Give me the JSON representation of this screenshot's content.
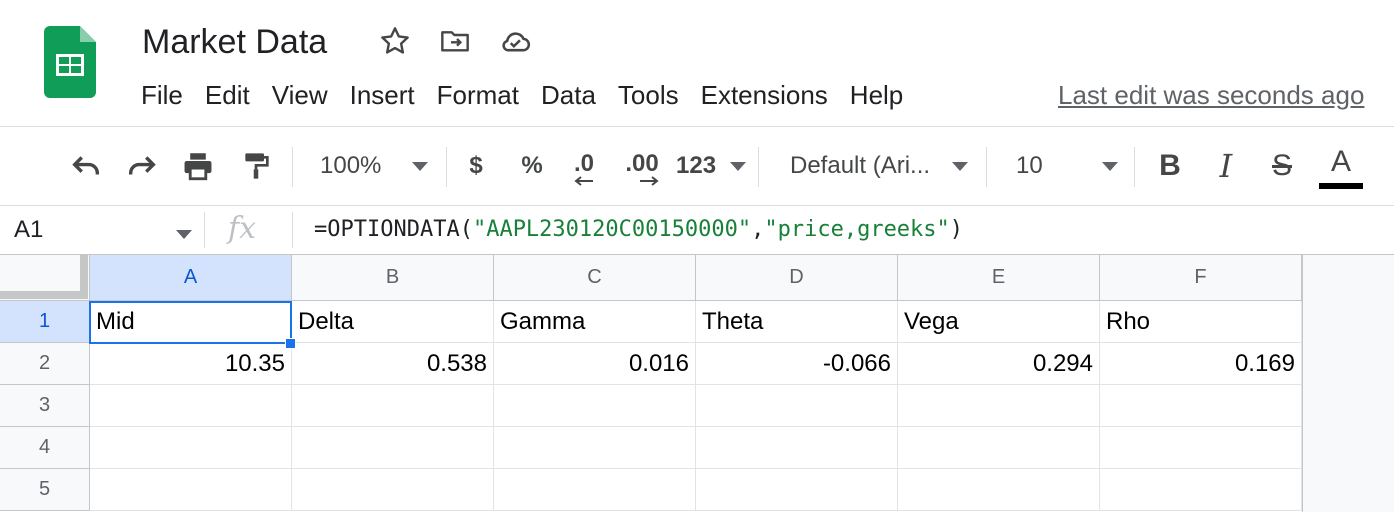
{
  "app": {
    "doc_title": "Market Data",
    "accent_green": "#0f9d58",
    "selection_blue": "#1a73e8",
    "icons": [
      "sheets-logo-icon",
      "star-icon",
      "move-to-folder-icon",
      "cloud-saved-icon"
    ]
  },
  "menu": {
    "items": [
      "File",
      "Edit",
      "View",
      "Insert",
      "Format",
      "Data",
      "Tools",
      "Extensions",
      "Help"
    ],
    "last_edit": "Last edit was seconds ago"
  },
  "toolbar": {
    "zoom": "100%",
    "currency": "$",
    "percent": "%",
    "decrease_decimal": ".0",
    "increase_decimal": ".00",
    "more_formats": "123",
    "font_family": "Default (Ari...",
    "font_size": "10",
    "bold": "B",
    "italic": "I",
    "strike": "S",
    "text_color": "A",
    "icons": [
      "undo-icon",
      "redo-icon",
      "print-icon",
      "paint-format-icon"
    ]
  },
  "formula_bar": {
    "cell_ref": "A1",
    "fx": "fx",
    "formula_prefix": "=OPTIONDATA(",
    "arg1": "\"AAPL230120C00150000\"",
    "comma": ",",
    "arg2": "\"price,greeks\"",
    "formula_suffix": ")"
  },
  "sheet": {
    "columns": [
      "A",
      "B",
      "C",
      "D",
      "E",
      "F"
    ],
    "rows": [
      "1",
      "2",
      "3",
      "4",
      "5"
    ],
    "row1": [
      "Mid",
      "Delta",
      "Gamma",
      "Theta",
      "Vega",
      "Rho"
    ],
    "row2": [
      "10.35",
      "0.538",
      "0.016",
      "-0.066",
      "0.294",
      "0.169"
    ],
    "selected_cell": "A1"
  }
}
